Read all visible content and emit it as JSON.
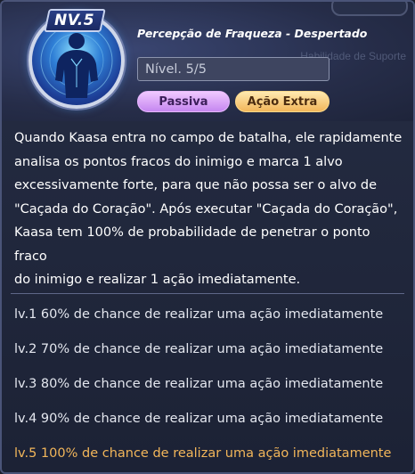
{
  "background": {
    "partial_label": "Habilidade de Suporte"
  },
  "skill": {
    "level_badge": "NV.5",
    "name": "Percepção de Fraqueza - Despertado",
    "level_value": "Nível. 5/5",
    "icon": "human-figure-scan-icon",
    "tags": {
      "passive": "Passiva",
      "extra_action": "Ação Extra"
    }
  },
  "description": {
    "lines": [
      "Quando Kaasa entra no campo de batalha, ele rapidamente",
      "analisa os pontos fracos do inimigo e marca 1 alvo",
      "excessivamente forte, para que não possa ser o alvo de",
      "\"Caçada do Coração\". Após executar \"Caçada do Coração\",",
      "Kaasa tem 100% de probabilidade de penetrar o ponto fraco",
      "do inimigo e realizar 1 ação imediatamente."
    ]
  },
  "levels": [
    "lv.1 60% de chance de realizar uma ação imediatamente",
    "lv.2 70% de chance de realizar uma ação imediatamente",
    "lv.3 80% de chance de realizar uma ação imediatamente",
    "lv.4 90% de chance de realizar uma ação imediatamente",
    "lv.5 100% de chance de realizar uma ação imediatamente"
  ],
  "colors": {
    "current_level": "#f2b65a",
    "passive_tag": "#c586f0",
    "extra_action_tag": "#f2b65a"
  }
}
